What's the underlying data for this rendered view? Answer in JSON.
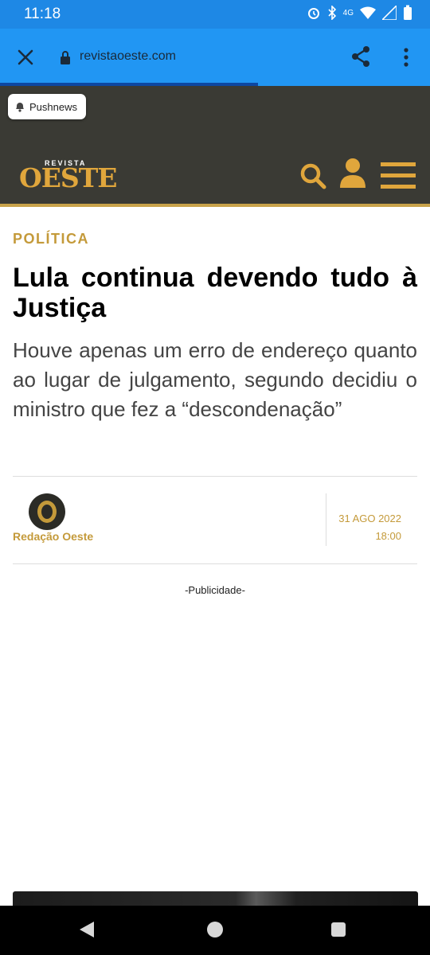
{
  "status": {
    "time": "11:18",
    "network": "4G"
  },
  "browser": {
    "url": "revistaoeste.com",
    "load_progress": 0.6
  },
  "site": {
    "push_label": "Pushnews",
    "logo_small": "REVISTA",
    "logo_main": "OESTE",
    "colors": {
      "header_bg": "#3a3a34",
      "accent": "#c49a3a"
    }
  },
  "article": {
    "category": "POLÍTICA",
    "title": "Lula continua devendo tudo à Justiça",
    "subtitle": "Houve apenas um erro de endereço quanto ao lugar de julgamento, segundo decidiu o ministro que fez a “descondenação”",
    "author": "Redação Oeste",
    "date": "31 AGO 2022",
    "time": "18:00"
  },
  "ad_label": "-Publicidade-"
}
